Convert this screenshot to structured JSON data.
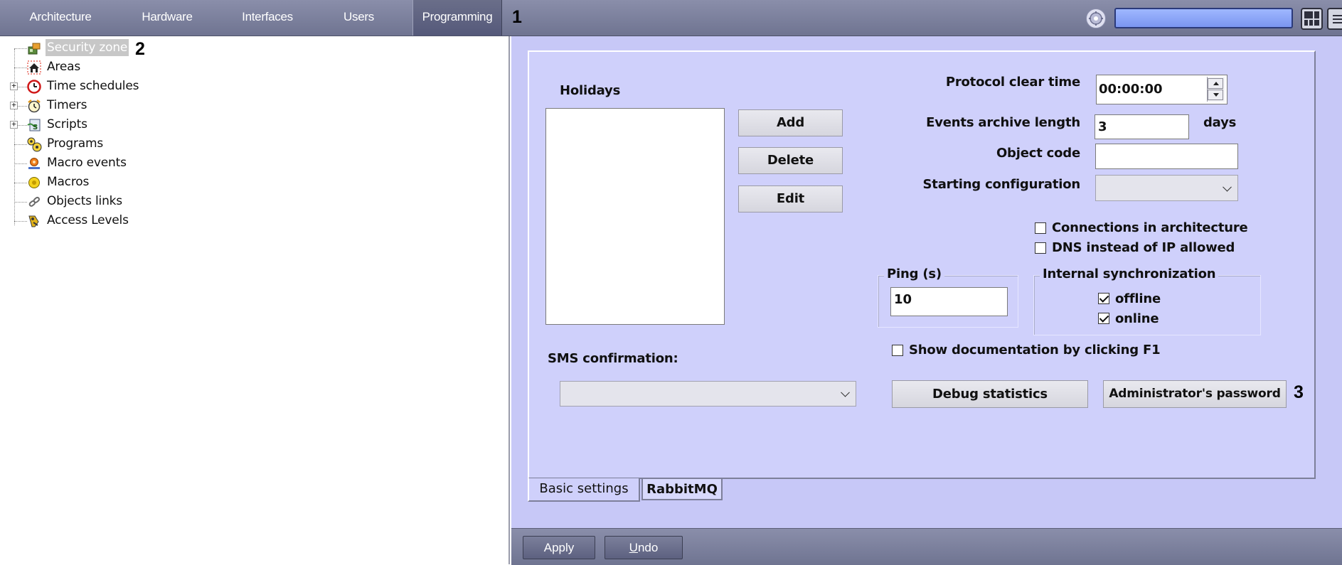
{
  "top_tabs": [
    {
      "label": "Architecture"
    },
    {
      "label": "Hardware"
    },
    {
      "label": "Interfaces"
    },
    {
      "label": "Users"
    },
    {
      "label": "Programming"
    }
  ],
  "callouts": {
    "one": "1",
    "two": "2",
    "three": "3"
  },
  "search": {
    "value": ""
  },
  "tree": {
    "items": [
      {
        "label": "Security zone",
        "icon": "security-zone-icon",
        "selected": true
      },
      {
        "label": "Areas",
        "icon": "house-icon"
      },
      {
        "label": "Time schedules",
        "icon": "clock-icon",
        "expandable": true
      },
      {
        "label": "Timers",
        "icon": "alarm-clock-icon",
        "expandable": true
      },
      {
        "label": "Scripts",
        "icon": "script-icon",
        "expandable": true
      },
      {
        "label": "Programs",
        "icon": "programs-icon"
      },
      {
        "label": "Macro events",
        "icon": "macro-event-icon"
      },
      {
        "label": "Macros",
        "icon": "macro-icon"
      },
      {
        "label": "Objects links",
        "icon": "link-icon"
      },
      {
        "label": "Access Levels",
        "icon": "access-levels-icon"
      }
    ],
    "expander_symbol": "+"
  },
  "settings": {
    "holidays_label": "Holidays",
    "add_label": "Add",
    "delete_label": "Delete",
    "edit_label": "Edit",
    "protocol_clear_time_label": "Protocol clear time",
    "protocol_clear_time_value": "00:00:00",
    "events_archive_length_label": "Events archive length",
    "events_archive_length_value": "3",
    "days_label": "days",
    "object_code_label": "Object code",
    "object_code_value": "",
    "starting_configuration_label": "Starting configuration",
    "starting_configuration_value": "",
    "connections_in_architecture_label": "Connections in architecture",
    "connections_in_architecture_checked": false,
    "dns_instead_of_ip_label": "DNS instead of IP allowed",
    "dns_instead_of_ip_checked": false,
    "ping_label": "Ping (s)",
    "ping_value": "10",
    "internal_sync_label": "Internal synchronization",
    "offline_label": "offline",
    "offline_checked": true,
    "online_label": "online",
    "online_checked": true,
    "show_docs_label": "Show documentation by clicking F1",
    "show_docs_checked": false,
    "sms_confirmation_label": "SMS confirmation:",
    "sms_confirmation_value": "",
    "debug_statistics_label": "Debug statistics",
    "admin_password_label": "Administrator's password"
  },
  "bottom_tabs": [
    {
      "label": "Basic settings",
      "active": true
    },
    {
      "label": "RabbitMQ"
    }
  ],
  "footer": {
    "apply_label": "Apply",
    "undo_label": "Undo",
    "undo_accesskey": "U"
  },
  "colors": {
    "topbar": "#7c809d",
    "panel_bg": "#c7c8f7",
    "frame_bg": "#cfd0fb",
    "search_fill": "#8ca6f7"
  }
}
